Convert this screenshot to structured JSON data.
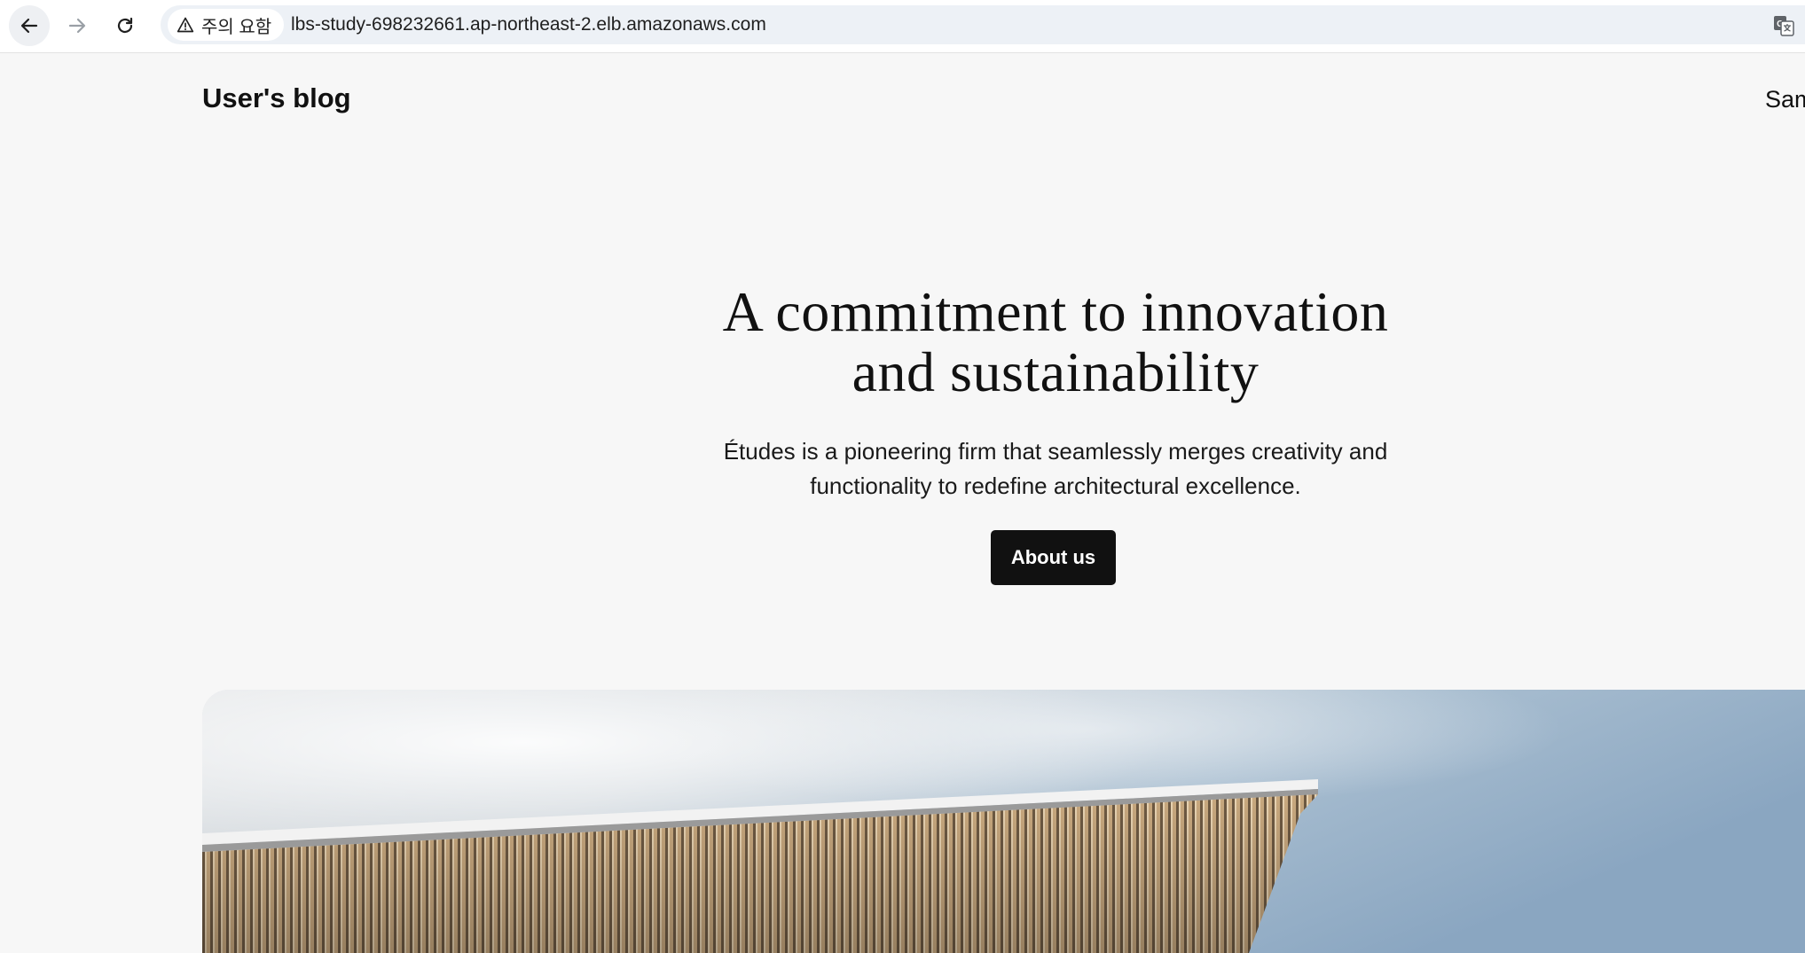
{
  "browser": {
    "security_label": "주의 요함",
    "url": "lbs-study-698232661.ap-northeast-2.elb.amazonaws.com",
    "icons": {
      "back": "arrow-left-icon",
      "forward": "arrow-right-icon",
      "reload": "reload-icon",
      "security": "warning-triangle-icon",
      "translate": "translate-icon"
    }
  },
  "site": {
    "title": "User's blog",
    "nav_item": "Sam"
  },
  "hero": {
    "heading_line1": "A commitment to innovation",
    "heading_line2": "and sustainability",
    "sub_line1": "Études is a pioneering firm that seamlessly merges creativity and",
    "sub_line2": "functionality to redefine architectural excellence.",
    "button_label": "About us"
  },
  "colors": {
    "page_background": "#f7f7f7",
    "button_background": "#111111",
    "button_text": "#ffffff",
    "omnibox_background": "#edf1f6"
  }
}
